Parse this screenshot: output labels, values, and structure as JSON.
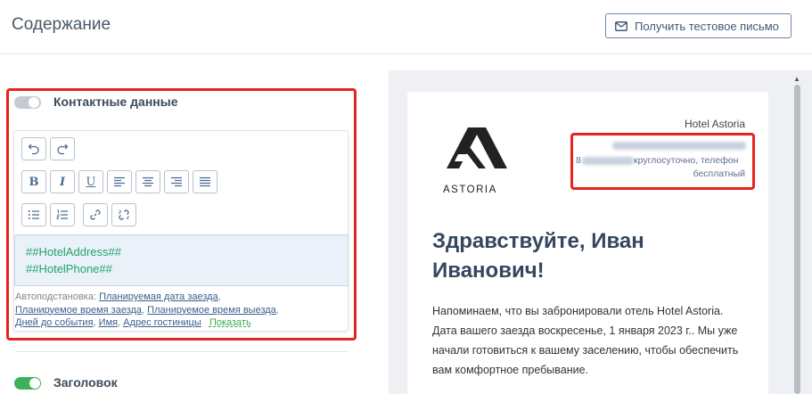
{
  "header": {
    "title": "Содержание",
    "test_button_label": "Получить тестовое письмо"
  },
  "sections": {
    "contacts": {
      "label": "Контактные данные",
      "enabled": false
    },
    "heading": {
      "label": "Заголовок",
      "enabled": true
    }
  },
  "editor": {
    "toolbar_row1": [
      "undo-icon",
      "redo-icon"
    ],
    "toolbar_row2": [
      "bold",
      "italic",
      "underline",
      "align-left",
      "align-center",
      "align-right",
      "align-justify"
    ],
    "toolbar_row3": [
      "bullet-list",
      "numbered-list",
      "link",
      "unlink"
    ],
    "bold_glyph": "B",
    "italic_glyph": "I",
    "underline_glyph": "U",
    "lines": [
      "##HotelAddress##",
      "##HotelPhone##"
    ]
  },
  "autosub": {
    "label": "Автоподстановка:",
    "items": [
      "Планируемая дата заезда",
      "Планируемое время заезда",
      "Планируемое время выезда",
      "Дней до события",
      "Имя",
      "Адрес гостиницы"
    ],
    "show_label": "Показать"
  },
  "preview": {
    "logo_text": "ASTORIA",
    "hotel_name": "Hotel Astoria",
    "phone_prefix": "8",
    "phone_suffix": " круглосуточно, телефон",
    "phone_free": "бесплатный",
    "greeting": "Здравствуйте, Иван Иванович!",
    "body": "Напоминаем, что вы забронировали отель Hotel Astoria. Дата вашего заезда воскресенье, 1 января 2023 г.. Мы уже начали готовиться к вашему заселению, чтобы обеспечить вам комфортное пребывание."
  },
  "colors": {
    "highlight_red": "#e8231e",
    "toggle_on": "#3db159",
    "toggle_off": "#c5cbd2",
    "placeholder_green": "#23a46b"
  }
}
